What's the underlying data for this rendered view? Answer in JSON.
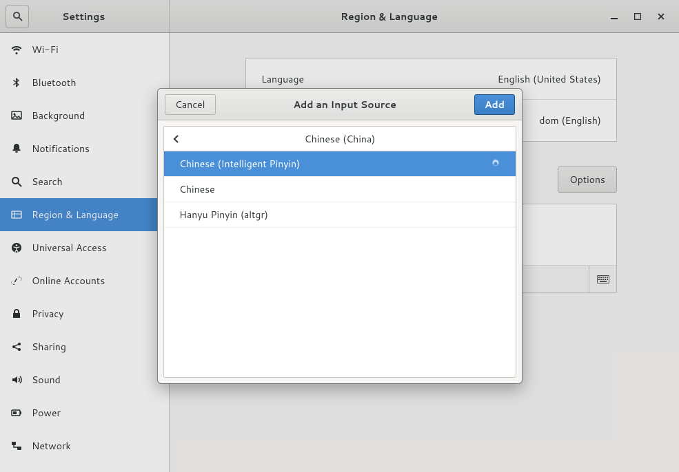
{
  "titlebar": {
    "left_title": "Settings",
    "right_title": "Region & Language"
  },
  "sidebar": {
    "items": [
      {
        "icon": "wifi",
        "label": "Wi-Fi"
      },
      {
        "icon": "bluetooth",
        "label": "Bluetooth"
      },
      {
        "icon": "background",
        "label": "Background"
      },
      {
        "icon": "notifications",
        "label": "Notifications"
      },
      {
        "icon": "search",
        "label": "Search"
      },
      {
        "icon": "region",
        "label": "Region & Language",
        "selected": true
      },
      {
        "icon": "universal",
        "label": "Universal Access"
      },
      {
        "icon": "online",
        "label": "Online Accounts"
      },
      {
        "icon": "privacy",
        "label": "Privacy"
      },
      {
        "icon": "sharing",
        "label": "Sharing"
      },
      {
        "icon": "sound",
        "label": "Sound"
      },
      {
        "icon": "power",
        "label": "Power"
      },
      {
        "icon": "network",
        "label": "Network"
      }
    ]
  },
  "region_panel": {
    "language_label": "Language",
    "language_value": "English (United States)",
    "formats_label": "",
    "formats_value": "dom (English)",
    "input_sources_label": "",
    "options_btn": "Options"
  },
  "dialog": {
    "title": "Add an Input Source",
    "cancel": "Cancel",
    "add": "Add",
    "breadcrumb": "Chinese (China)",
    "items": [
      {
        "label": "Chinese (Intelligent Pinyin)",
        "engine": true,
        "selected": true
      },
      {
        "label": "Chinese"
      },
      {
        "label": "Hanyu Pinyin (altgr)"
      }
    ]
  }
}
